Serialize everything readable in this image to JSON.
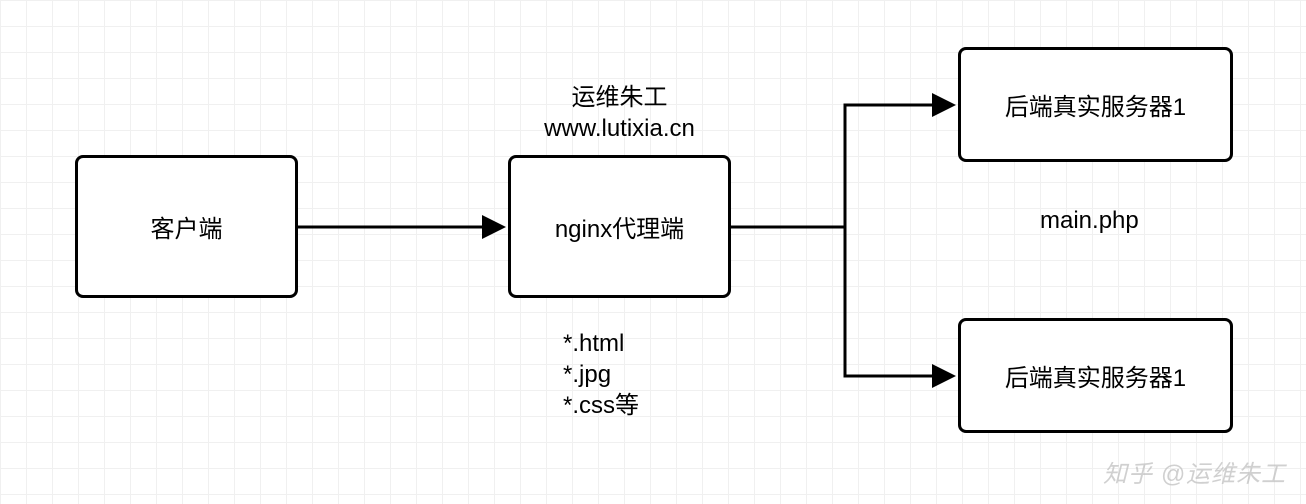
{
  "nodes": {
    "client": {
      "label": "客户端"
    },
    "proxy": {
      "label": "nginx代理端",
      "top_label_line1": "运维朱工",
      "top_label_line2": "www.lutixia.cn",
      "bottom_label_line1": "*.html",
      "bottom_label_line2": "*.jpg",
      "bottom_label_line3": "*.css等"
    },
    "backend1": {
      "label": "后端真实服务器1"
    },
    "backend2": {
      "label": "后端真实服务器1"
    },
    "middle_label": "main.php"
  },
  "watermark": "知乎 @运维朱工"
}
